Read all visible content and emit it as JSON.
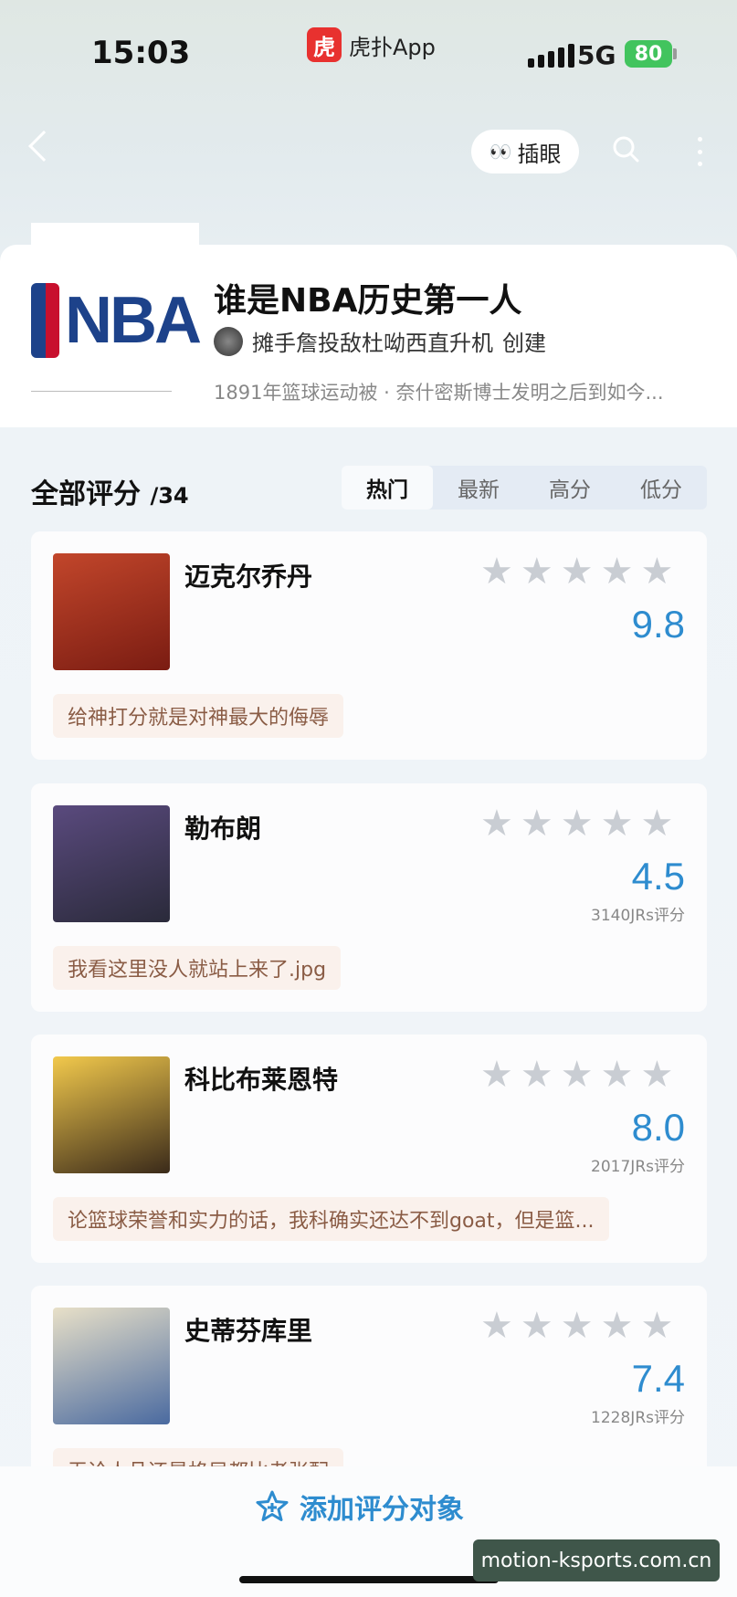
{
  "status_bar": {
    "time": "15:03",
    "app_icon_glyph": "虎",
    "app_name": "虎扑App",
    "network": "5G",
    "battery": "80"
  },
  "nav": {
    "peek_label": "插眼",
    "peek_icon": "eyes-icon"
  },
  "topic": {
    "logo_text": "NBA",
    "title": "谁是NBA历史第一人",
    "creator_name": "摊手詹投敌杜呦西直升机",
    "creator_suffix": "创建",
    "description": "1891年篮球运动被 · 奈什密斯博士发明之后到如今..."
  },
  "ratings": {
    "title": "全部评分",
    "count": "/34",
    "tabs": [
      {
        "label": "热门",
        "active": true
      },
      {
        "label": "最新",
        "active": false
      },
      {
        "label": "高分",
        "active": false
      },
      {
        "label": "低分",
        "active": false
      }
    ]
  },
  "items": [
    {
      "name": "迈克尔乔丹",
      "score": "9.8",
      "votes": "",
      "comment": "给神打分就是对神最大的侮辱",
      "avatar_colors": [
        "#c2462b",
        "#7a1c12"
      ]
    },
    {
      "name": "勒布朗",
      "score": "4.5",
      "votes": "3140JRs评分",
      "comment": "我看这里没人就站上来了.jpg",
      "avatar_colors": [
        "#5a4a7e",
        "#2a2a3a"
      ]
    },
    {
      "name": "科比布莱恩特",
      "score": "8.0",
      "votes": "2017JRs评分",
      "comment": "论篮球荣誉和实力的话，我科确实还达不到goat，但是篮...",
      "avatar_colors": [
        "#f2c94c",
        "#3a2a1a"
      ]
    },
    {
      "name": "史蒂芬库里",
      "score": "7.4",
      "votes": "1228JRs评分",
      "comment": "无论人品还是格局都比老张配",
      "avatar_colors": [
        "#e8e0c8",
        "#4a6aa0"
      ]
    }
  ],
  "bottom": {
    "add_label": "添加评分对象"
  },
  "watermark": "motion-ksports.com.cn",
  "colors": {
    "accent": "#2e8ccf",
    "nba_blue": "#1d428a",
    "nba_red": "#c8102e",
    "star_empty": "#c9cdd3"
  }
}
